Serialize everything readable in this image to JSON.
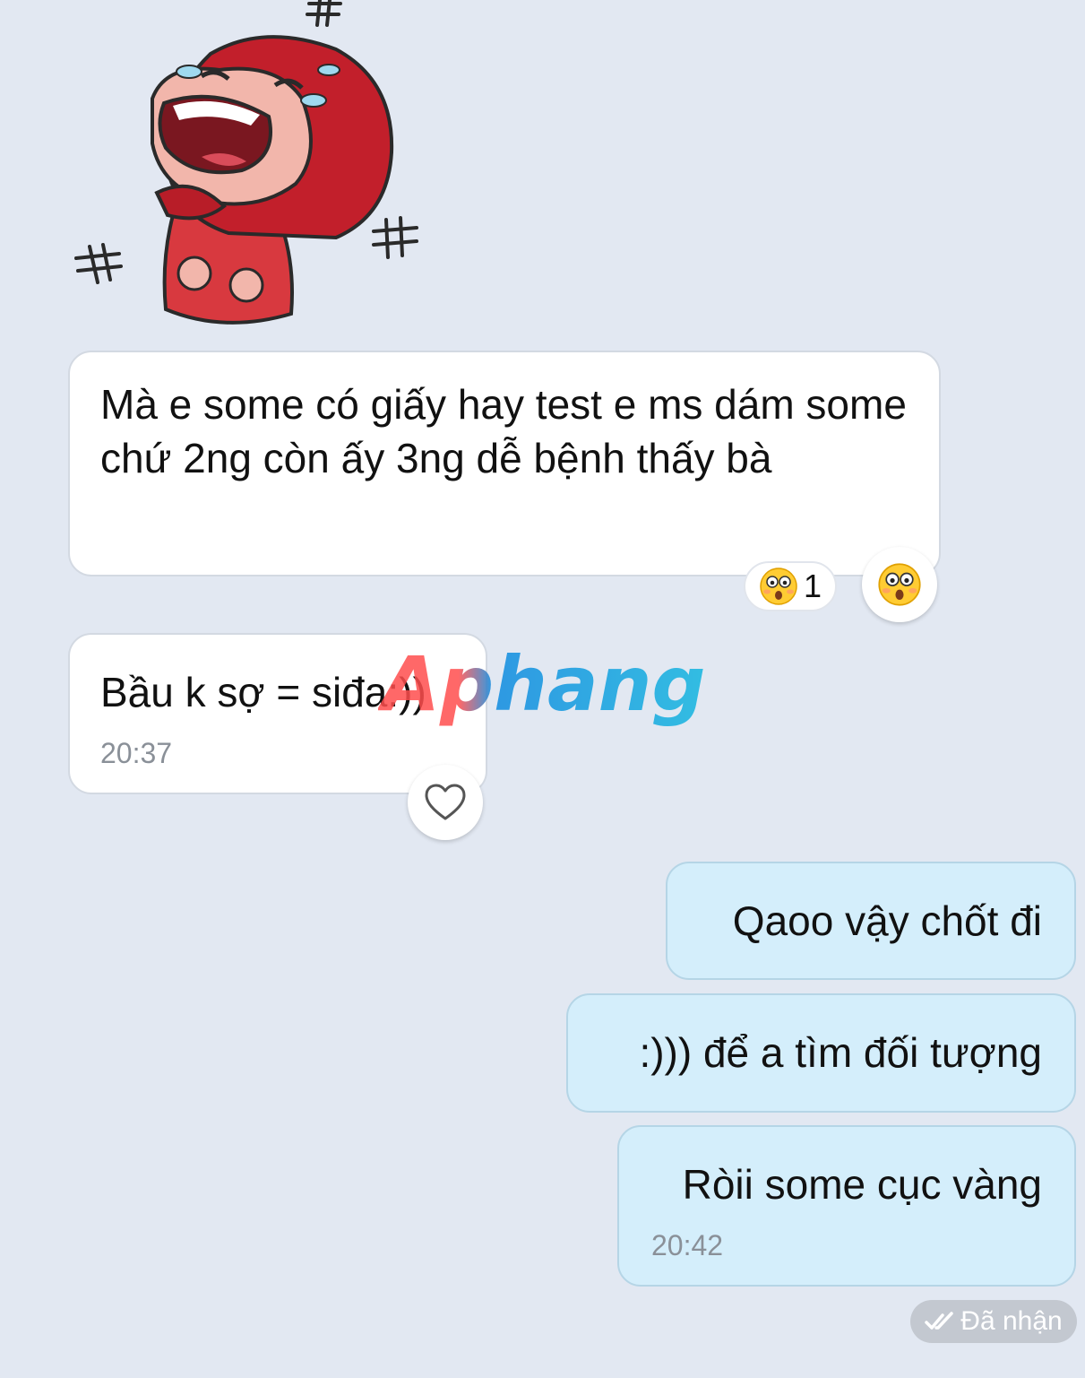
{
  "messages": [
    {
      "text": "Mà e some có giấy hay test e ms dám some chứ 2ng còn ấy 3ng dễ bệnh thấy bà"
    },
    {
      "text": "Bầu k sợ = siđa:))",
      "time": "20:37"
    },
    {
      "text": "Qaoo vậy chốt đi"
    },
    {
      "text": ":))) để a tìm đối tượng"
    },
    {
      "text": "Ròii some cục vàng",
      "time": "20:42"
    }
  ],
  "reaction": {
    "count": "1",
    "icon": "surprised-face-icon"
  },
  "watermark": {
    "text": "Aphang"
  },
  "status": {
    "label": "Đã nhận",
    "icon": "double-check-icon"
  },
  "colors": {
    "background": "#e2e8f2",
    "incoming_bubble": "#ffffff",
    "outgoing_bubble": "#d4eefb",
    "status_pill": "#c3c8d0"
  }
}
